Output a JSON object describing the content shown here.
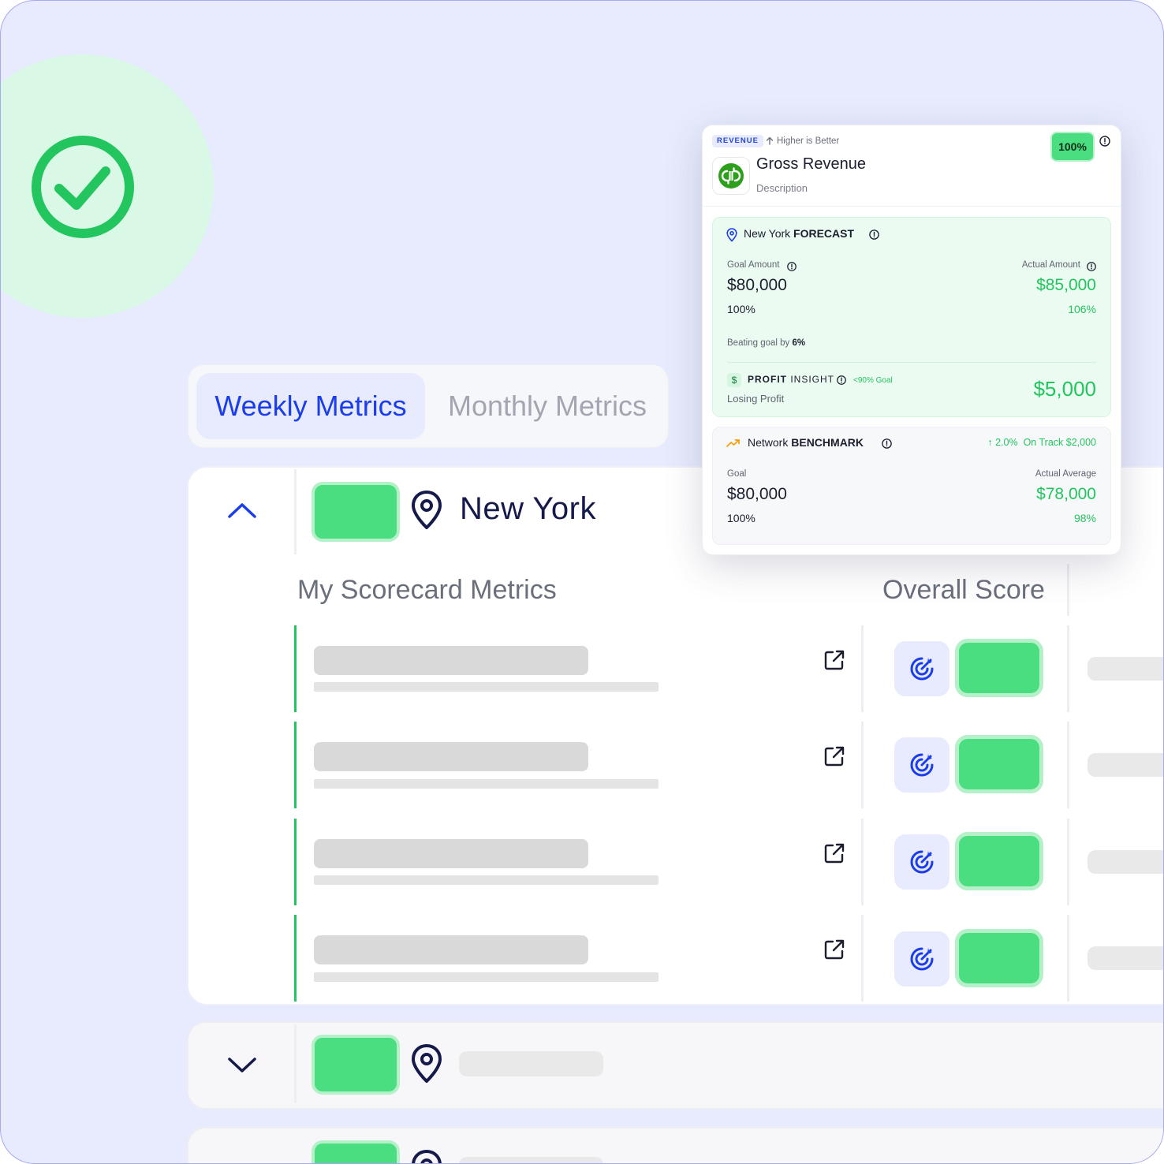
{
  "tabs": {
    "weekly": "Weekly Metrics",
    "monthly": "Monthly Metrics"
  },
  "location_group": {
    "title": "New York",
    "section_title": "My Scorecard Metrics",
    "score_title": "Overall Score"
  },
  "popover": {
    "category": "REVENUE",
    "direction": "Higher is Better",
    "score_badge": "100%",
    "title": "Gross Revenue",
    "description": "Description",
    "forecast": {
      "location": "New York",
      "label": "FORECAST",
      "goal_label": "Goal Amount",
      "goal_value": "$80,000",
      "goal_pct": "100%",
      "actual_label": "Actual Amount",
      "actual_value": "$85,000",
      "actual_pct": "106%",
      "beating_text": "Beating goal by",
      "beating_value": "6%",
      "profit_label": "PROFIT",
      "insight_label": "INSIGHT",
      "profit_goal_note": "<90% Goal",
      "profit_status": "Losing Profit",
      "profit_value": "$5,000"
    },
    "benchmark": {
      "network": "Network",
      "label": "BENCHMARK",
      "change": "2.0%",
      "on_track": "On Track $2,000",
      "goal_label": "Goal",
      "goal_value": "$80,000",
      "goal_pct": "100%",
      "actual_label": "Actual Average",
      "actual_value": "$78,000",
      "actual_pct": "98%"
    }
  },
  "colors": {
    "accent_blue": "#1b3dea",
    "success_green": "#22c55e",
    "pill_green": "#4ade80",
    "background": "#e7ebfd"
  }
}
